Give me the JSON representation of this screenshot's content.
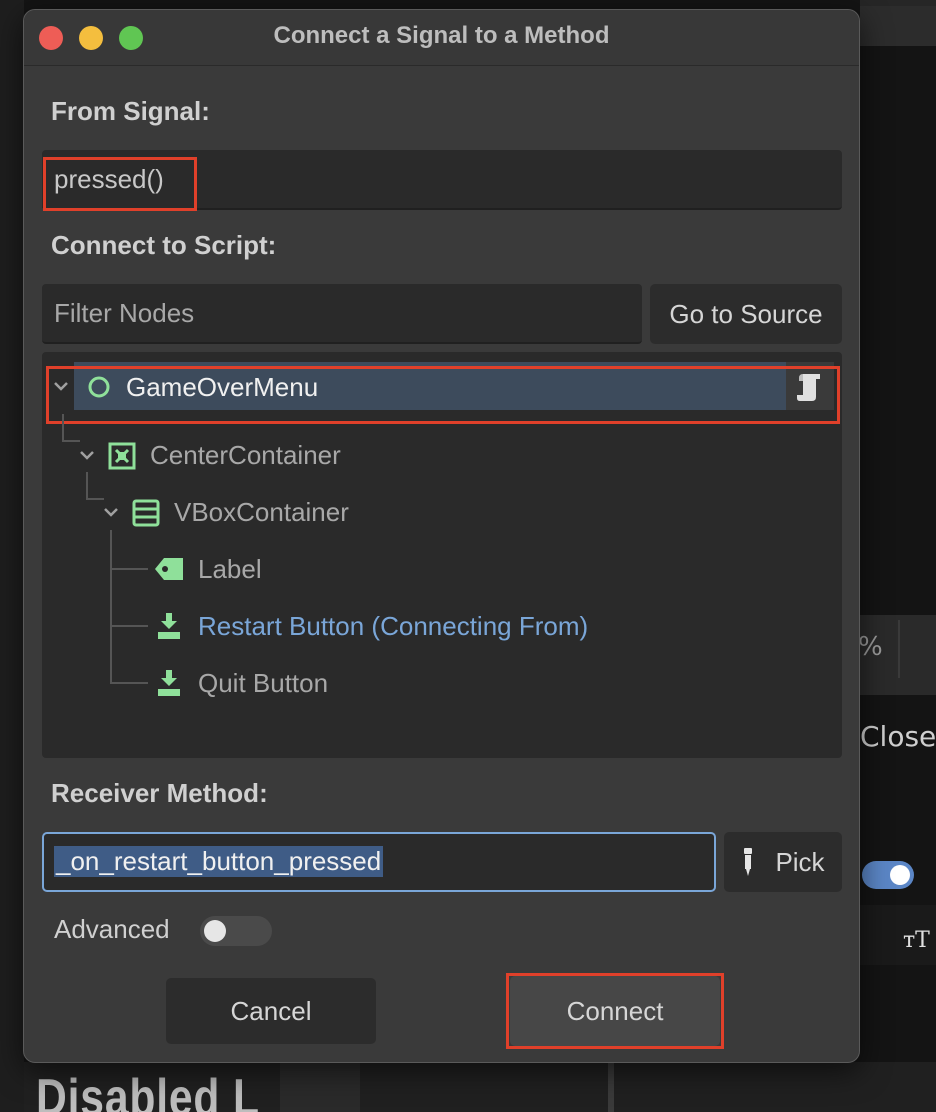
{
  "dialog": {
    "title": "Connect a Signal to a Method",
    "from_signal_label": "From Signal:",
    "signal_value": "pressed()",
    "connect_to_script_label": "Connect to Script:",
    "filter_placeholder": "Filter Nodes",
    "go_to_source_label": "Go to Source",
    "tree": [
      {
        "label": "GameOverMenu",
        "icon": "circle-node-icon",
        "selected": true,
        "has_script": true
      },
      {
        "label": "CenterContainer",
        "icon": "center-container-icon"
      },
      {
        "label": "VBoxContainer",
        "icon": "vbox-container-icon"
      },
      {
        "label": "Label",
        "icon": "label-tag-icon"
      },
      {
        "label": "Restart Button (Connecting From)",
        "icon": "button-icon",
        "connecting_from": true
      },
      {
        "label": "Quit Button",
        "icon": "button-icon"
      }
    ],
    "receiver_method_label": "Receiver Method:",
    "receiver_method_value": "_on_restart_button_pressed",
    "pick_label": "Pick",
    "advanced_label": "Advanced",
    "advanced_enabled": false,
    "cancel_label": "Cancel",
    "connect_label": "Connect"
  },
  "background": {
    "percent_text": "%",
    "close_text": "Close",
    "text_icon": "тT",
    "disabled_text": "Disabled L"
  },
  "colors": {
    "highlight": "#e0402a",
    "node_green": "#8fe09a",
    "connecting_blue": "#7aa6d8",
    "selection": "#3d4b5c"
  }
}
